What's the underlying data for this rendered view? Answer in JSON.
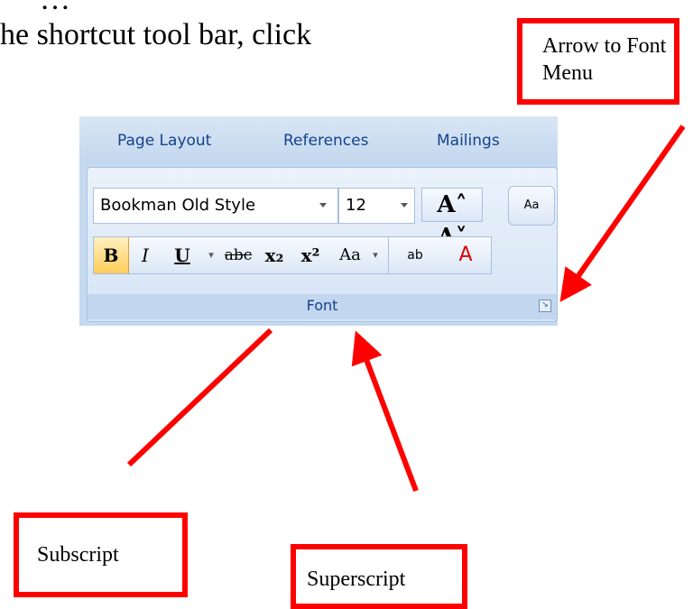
{
  "intro": {
    "line1": "…",
    "line2": "he shortcut tool bar, click"
  },
  "callouts": {
    "font_menu": "Arrow to Font Menu",
    "subscript": "Subscript",
    "superscript": "Superscript"
  },
  "ribbon": {
    "tabs": [
      "Page Layout",
      "References",
      "Mailings"
    ],
    "font_name": "Bookman Old Style",
    "font_size": "12",
    "grow_shrink": "A˄ A˅",
    "clear_format": "Aa",
    "format_buttons": {
      "bold": "B",
      "italic": "I",
      "underline": "U",
      "strikethrough": "abc",
      "subscript": "x₂",
      "superscript": "x²",
      "change_case": "Aa",
      "highlight": "ab",
      "font_color": "A"
    },
    "group_label": "Font"
  },
  "colors": {
    "arrow": "#ff0000",
    "ribbon_text": "#15428b"
  }
}
